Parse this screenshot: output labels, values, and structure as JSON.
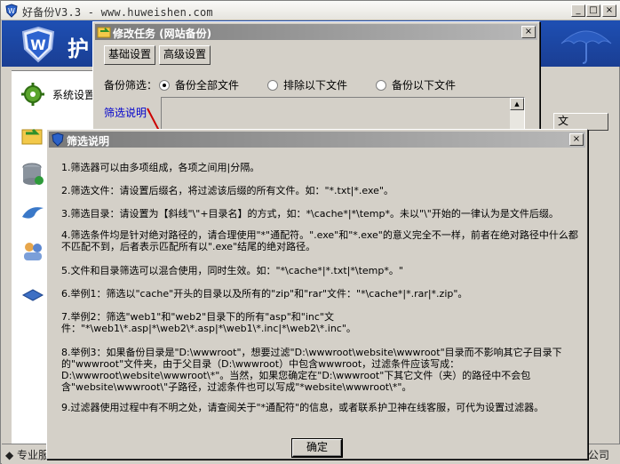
{
  "main_window": {
    "title": "好备份V3.3 - www.huweishen.com",
    "brand_text": "护",
    "sidebar": {
      "items": [
        {
          "label": "系统设置",
          "icon": "gear-icon"
        },
        {
          "label": "",
          "icon": "folder-sync-icon"
        },
        {
          "label": "",
          "icon": "database-icon"
        },
        {
          "label": "",
          "icon": "dolphin-icon"
        },
        {
          "label": "",
          "icon": "users-icon"
        },
        {
          "label": "",
          "icon": "book-icon"
        }
      ]
    },
    "bottom_left": "◆ 专业服",
    "bottom_right": "公司",
    "right_button": "文"
  },
  "task_window": {
    "title": "修改任务 (网站备份)",
    "tabs": [
      "基础设置",
      "高级设置"
    ],
    "filter_label": "备份筛选：",
    "filter_options": [
      {
        "label": "备份全部文件",
        "selected": true
      },
      {
        "label": "排除以下文件",
        "selected": false
      },
      {
        "label": "备份以下文件",
        "selected": false
      }
    ],
    "filter_help_link": "筛选说明"
  },
  "help_dialog": {
    "title": "筛选说明",
    "items": [
      "1.筛选器可以由多项组成，各项之间用|分隔。",
      "2.筛选文件：请设置后缀名，将过滤该后缀的所有文件。如：\"*.txt|*.exe\"。",
      "3.筛选目录：请设置为【斜线\"\\\"+目录名】的方式，如：*\\cache*|*\\temp*。未以\"\\\"开始的一律认为是文件后缀。",
      "4.筛选条件均是针对绝对路径的，请合理使用\"*\"通配符。\".exe\"和\"*.exe\"的意义完全不一样，前者在绝对路径中什么都不匹配不到，后者表示匹配所有以\".exe\"结尾的绝对路径。",
      "5.文件和目录筛选可以混合使用，同时生效。如：\"*\\cache*|*.txt|*\\temp*。\"",
      "6.举例1：筛选以\"cache\"开头的目录以及所有的\"zip\"和\"rar\"文件：\"*\\cache*|*.rar|*.zip\"。",
      "7.举例2：筛选\"web1\"和\"web2\"目录下的所有\"asp\"和\"inc\"文件：\"*\\web1\\*.asp|*\\web2\\*.asp|*\\web1\\*.inc|*\\web2\\*.inc\"。",
      "8.举例3：如果备份目录是\"D:\\wwwroot\"，想要过滤\"D:\\wwwroot\\website\\wwwroot\"目录而不影响其它子目录下的\"wwwroot\"文件夹，由于父目录（D:\\wwwroot）中包含wwwroot，过滤条件应该写成：D:\\wwwroot\\website\\wwwroot\\*\"。当然，如果您确定在\"D:\\wwwroot\"下其它文件（夹）的路径中不会包含\"website\\wwwroot\\\"子路径，过滤条件也可以写成\"*website\\wwwroot\\*\"。",
      "9.过滤器使用过程中有不明之处，请查阅关于\"*通配符\"的信息，或者联系护卫神在线客服，可代为设置过滤器。"
    ],
    "ok_label": "确定"
  },
  "colors": {
    "banner_blue": "#1e4fb3",
    "inactive_title": "#7a7a7a",
    "link_blue": "#0000cc",
    "arrow_red": "#cc0000"
  }
}
